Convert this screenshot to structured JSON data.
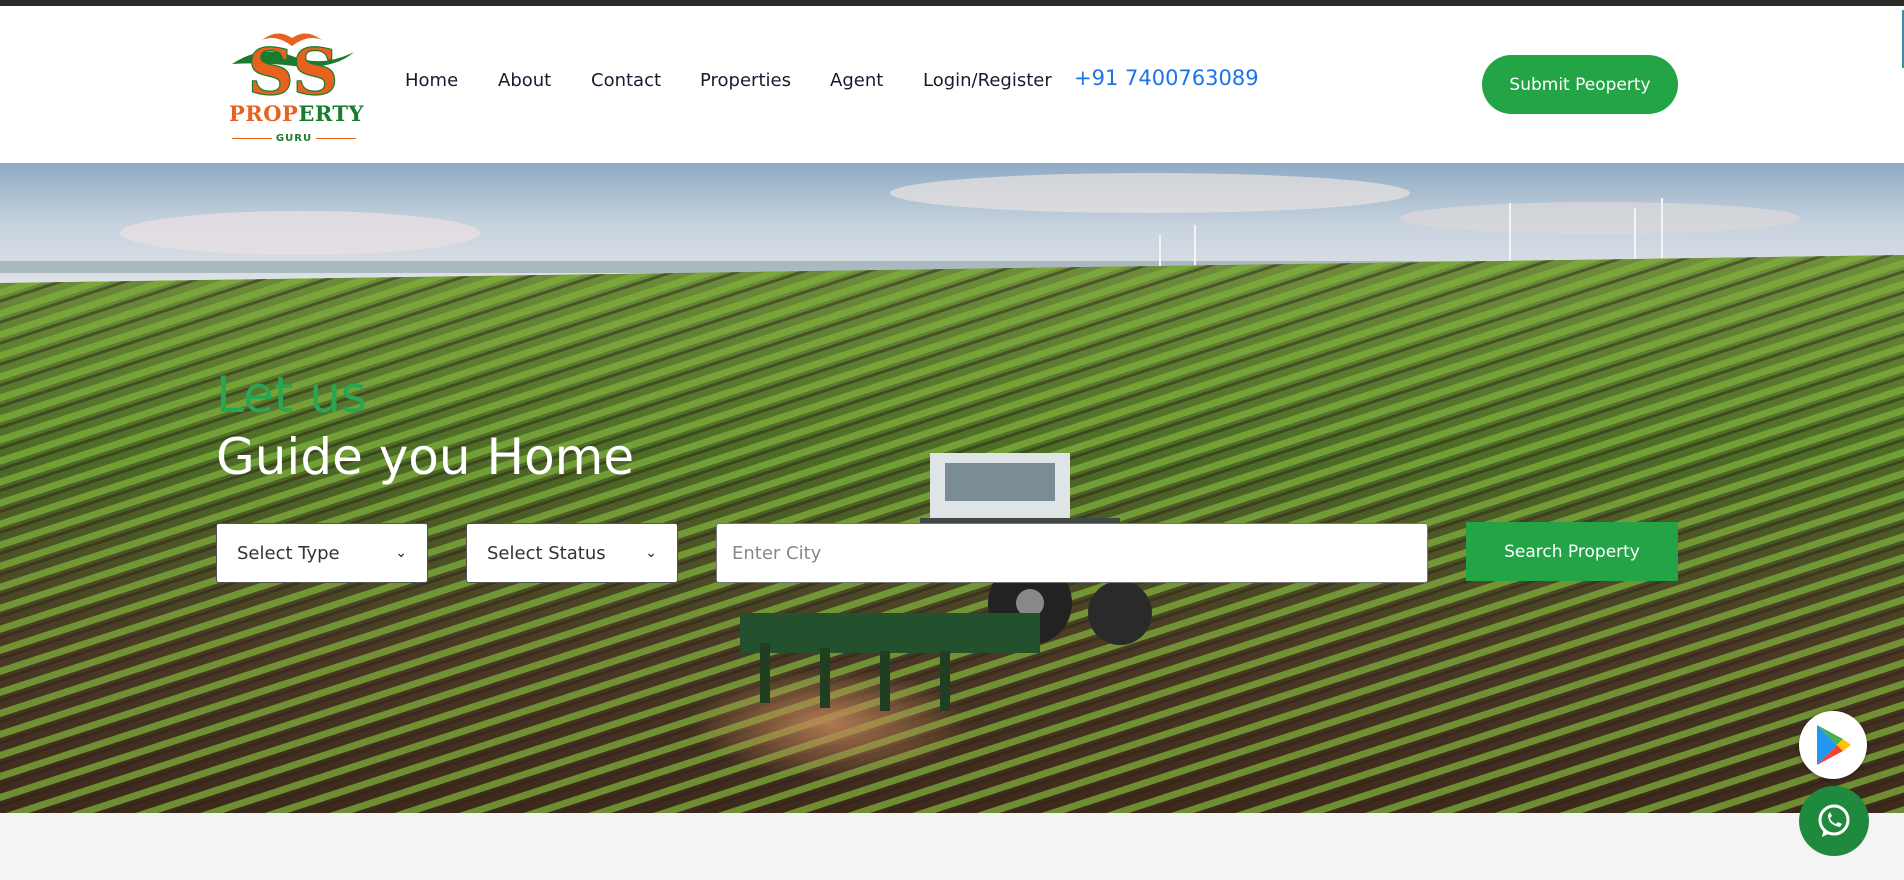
{
  "brand": {
    "logo_initials": "SS",
    "logo_word_part1": "PROP",
    "logo_word_part2": "ERTY",
    "logo_sub": "GURU",
    "colors": {
      "orange": "#e8621f",
      "green": "#1a7a2e"
    }
  },
  "nav": {
    "items": [
      {
        "label": "Home"
      },
      {
        "label": "About"
      },
      {
        "label": "Contact"
      },
      {
        "label": "Properties"
      },
      {
        "label": "Agent"
      },
      {
        "label": "Login/Register"
      }
    ],
    "phone": "+91 7400763089"
  },
  "header": {
    "submit_label": "Submit Peoperty"
  },
  "hero": {
    "line1": "Let us",
    "line2": "Guide you Home",
    "search": {
      "type_select": "Select Type",
      "status_select": "Select Status",
      "city_placeholder": "Enter City",
      "button_label": "Search Property"
    }
  },
  "floating": {
    "play_icon": "google-play-icon",
    "whatsapp_icon": "whatsapp-icon"
  },
  "theme": {
    "accent": "#22a447",
    "phone_color": "#1e73e8"
  }
}
